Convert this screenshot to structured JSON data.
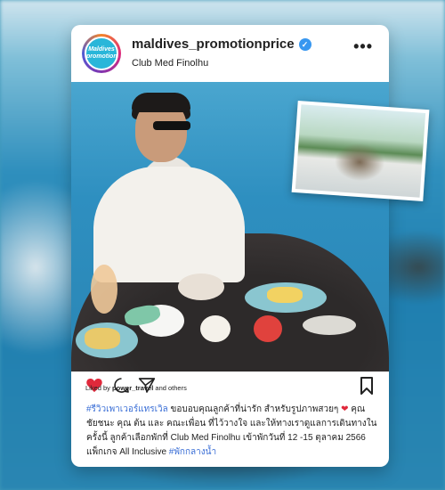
{
  "post": {
    "username": "maldives_promotionprice",
    "location": "Club Med Finolhu",
    "avatar_text": [
      "Maldives",
      "promotion"
    ],
    "more_icon": "more-horizontal-icon",
    "liked_by_prefix": "Liked by",
    "liked_by_user": "power_travel",
    "liked_by_suffix": "and others",
    "caption_tag1": "#รีวิวเพาเวอร์แทรเวิล",
    "caption_text1": " ขอบอบคุณลูกค้าที่น่ารัก สำหรับรูปภาพสวยๆ ",
    "caption_text2": " คุณ ชัยชนะ คุณ ต้น และ คณะเพื่อน ที่ไว้วางใจ และให้ทางเราดูแลการเดินทางในครั้งนี้ ลูกค้าเลือกพักที่ Club Med Finolhu เข้าพักวันที่ 12 -15 ตุลาคม 2566 แพ็กเกจ All Inclusive ",
    "caption_tag2": "#พักกลางน้ำ",
    "heart_emoji": "❤"
  },
  "colors": {
    "like_red": "#e0293b",
    "hashtag_blue": "#3b6fd6",
    "verified_blue": "#3897f0"
  }
}
